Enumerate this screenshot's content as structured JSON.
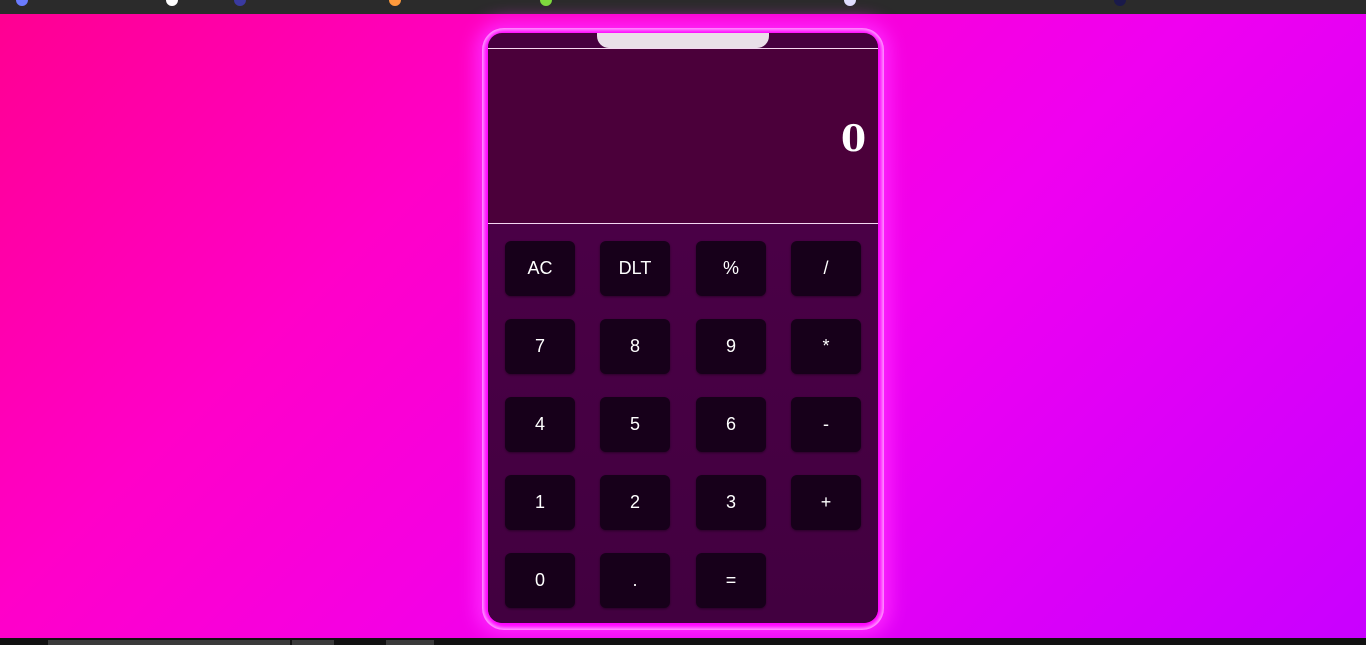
{
  "display": {
    "value": "0"
  },
  "keys": {
    "row1": [
      "AC",
      "DLT",
      "%",
      "/"
    ],
    "row2": [
      "7",
      "8",
      "9",
      "*"
    ],
    "row3": [
      "4",
      "5",
      "6",
      "-"
    ],
    "row4": [
      "1",
      "2",
      "3",
      "+"
    ],
    "row5": [
      "0",
      ".",
      "="
    ]
  },
  "colors": {
    "background_start": "#ff0090",
    "background_end": "#c800ff",
    "calculator_body": "#46003f",
    "display_bg": "#4b003a",
    "key_bg": "#17001a",
    "glow": "#ff00ff"
  }
}
